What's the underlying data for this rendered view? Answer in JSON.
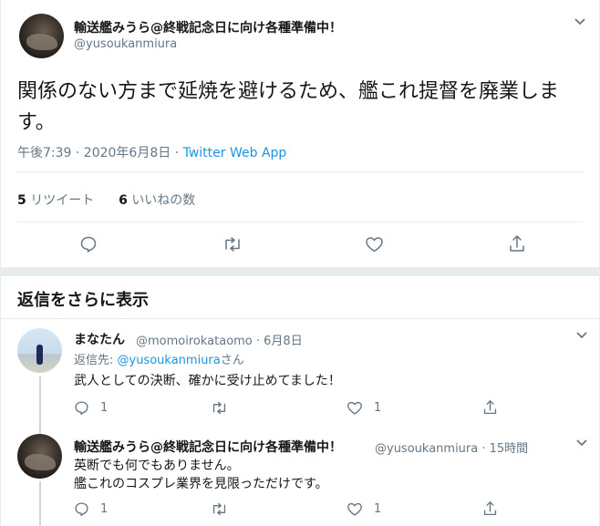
{
  "main_tweet": {
    "display_name": "輸送艦みうら@終戦記念日に向け各種準備中！",
    "handle": "@yusoukanmiura",
    "text": "関係のない方まで延焼を避けるため、艦これ提督を廃業します。",
    "time": "午後7:39 · 2020年6月8日 · ",
    "source": "Twitter Web App",
    "retweets_count": "5",
    "retweets_label": "リツイート",
    "likes_count": "6",
    "likes_label": "いいねの数"
  },
  "more_replies_header": "返信をさらに表示",
  "replies": [
    {
      "display_name": "まなたん",
      "handle": "@momoirokataomo · 6月8日",
      "reply_to_prefix": "返信先: ",
      "reply_to_handle": "@yusoukanmiura",
      "reply_to_suffix": "さん",
      "text": [
        "武人としての決断、確かに受け止めてました！"
      ],
      "reply_count": "1",
      "like_count": "1"
    },
    {
      "display_name": "輸送艦みうら@終戦記念日に向け各種準備中！",
      "handle": "@yusoukanmiura · 15時間",
      "text": [
        "英断でも何でもありません。",
        "艦これのコスプレ業界を見限っただけです。"
      ],
      "reply_count": "1",
      "like_count": "1"
    }
  ],
  "icons": {
    "reply": "reply-icon",
    "retweet": "retweet-icon",
    "like": "heart-icon",
    "share": "share-icon",
    "menu": "chevron-down-icon"
  },
  "colors": {
    "link": "#1b95e0",
    "secondary_text": "#657786",
    "divider": "#e6ecf0"
  }
}
